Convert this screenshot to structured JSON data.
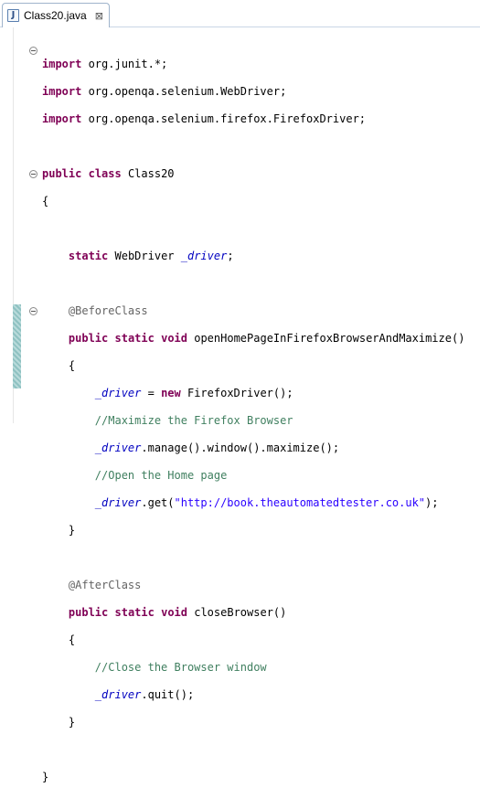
{
  "tab": {
    "title": "Class20.java",
    "file_icon": "java-file-icon",
    "file_icon_glyph": "J",
    "close_glyph": "⊠"
  },
  "colors": {
    "keyword": "#7f0055",
    "annotation": "#646464",
    "field": "#0000c0",
    "comment": "#3f7f5f",
    "string": "#2a00ff"
  },
  "code": {
    "import1_kw": "import",
    "import1_rest": " org.junit.*;",
    "import2_kw": "import",
    "import2_rest": " org.openqa.selenium.WebDriver;",
    "import3_kw": "import",
    "import3_rest": " org.openqa.selenium.firefox.FirefoxDriver;",
    "class_kw_public": "public",
    "class_kw_class": "class",
    "class_name": " Class20",
    "open_brace": "{",
    "close_brace": "}",
    "field_kw_static": "static",
    "field_type": " WebDriver ",
    "field_name": "_driver",
    "semicolon": ";",
    "before_annotation": "@BeforeClass",
    "kw_public": "public",
    "kw_static": "static",
    "kw_void": "void",
    "kw_new": "new",
    "method1_name": " openHomePageInFirefoxBrowserAndMaximize()",
    "m1_l1_rest_a": " = ",
    "m1_l1_rest_b": " FirefoxDriver();",
    "m1_comment1": "//Maximize the Firefox Browser",
    "m1_l2_rest": ".manage().window().maximize();",
    "m1_comment2": "//Open the Home page",
    "m1_l3_rest_a": ".get(",
    "m1_l3_string": "\"http://book.theautomatedtester.co.uk\"",
    "m1_l3_rest_b": ");",
    "after_annotation": "@AfterClass",
    "method2_name": " closeBrowser()",
    "m2_comment": "//Close the Browser window",
    "m2_l1_rest": ".quit();"
  }
}
